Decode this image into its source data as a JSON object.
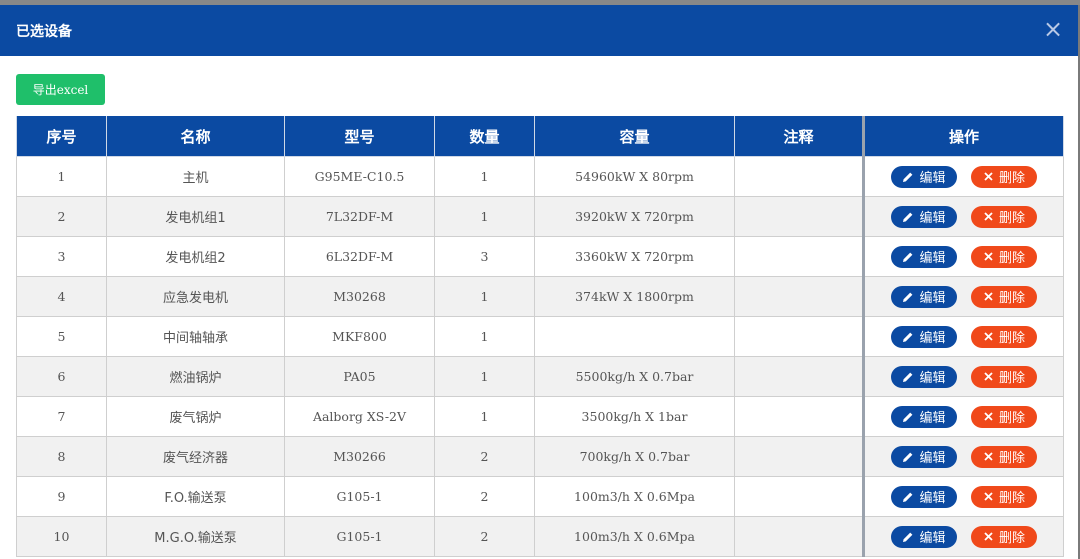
{
  "dialog": {
    "title": "已选设备",
    "close_label": "×",
    "export_label": "导出excel"
  },
  "table": {
    "headers": [
      "序号",
      "名称",
      "型号",
      "数量",
      "容量",
      "注释",
      "操作"
    ],
    "rows": [
      {
        "no": "1",
        "name": "主机",
        "model": "G95ME-C10.5",
        "qty": "1",
        "capacity": "54960kW X 80rpm",
        "note": ""
      },
      {
        "no": "2",
        "name": "发电机组1",
        "model": "7L32DF-M",
        "qty": "1",
        "capacity": "3920kW X 720rpm",
        "note": ""
      },
      {
        "no": "3",
        "name": "发电机组2",
        "model": "6L32DF-M",
        "qty": "3",
        "capacity": "3360kW X 720rpm",
        "note": ""
      },
      {
        "no": "4",
        "name": "应急发电机",
        "model": "M30268",
        "qty": "1",
        "capacity": "374kW X 1800rpm",
        "note": ""
      },
      {
        "no": "5",
        "name": "中间轴轴承",
        "model": "MKF800",
        "qty": "1",
        "capacity": "",
        "note": ""
      },
      {
        "no": "6",
        "name": "燃油锅炉",
        "model": "PA05",
        "qty": "1",
        "capacity": "5500kg/h X 0.7bar",
        "note": ""
      },
      {
        "no": "7",
        "name": "废气锅炉",
        "model": "Aalborg XS-2V",
        "qty": "1",
        "capacity": "3500kg/h X 1bar",
        "note": ""
      },
      {
        "no": "8",
        "name": "废气经济器",
        "model": "M30266",
        "qty": "2",
        "capacity": "700kg/h X 0.7bar",
        "note": ""
      },
      {
        "no": "9",
        "name": "F.O.输送泵",
        "model": "G105-1",
        "qty": "2",
        "capacity": "100m3/h X 0.6Mpa",
        "note": ""
      },
      {
        "no": "10",
        "name": "M.G.O.输送泵",
        "model": "G105-1",
        "qty": "2",
        "capacity": "100m3/h X 0.6Mpa",
        "note": ""
      }
    ],
    "actions": {
      "edit_label": "编辑",
      "delete_label": "删除"
    }
  },
  "colors": {
    "header": "#0b4aa2",
    "export": "#1fbf6a",
    "edit": "#0b4aa2",
    "delete": "#f0491a"
  }
}
